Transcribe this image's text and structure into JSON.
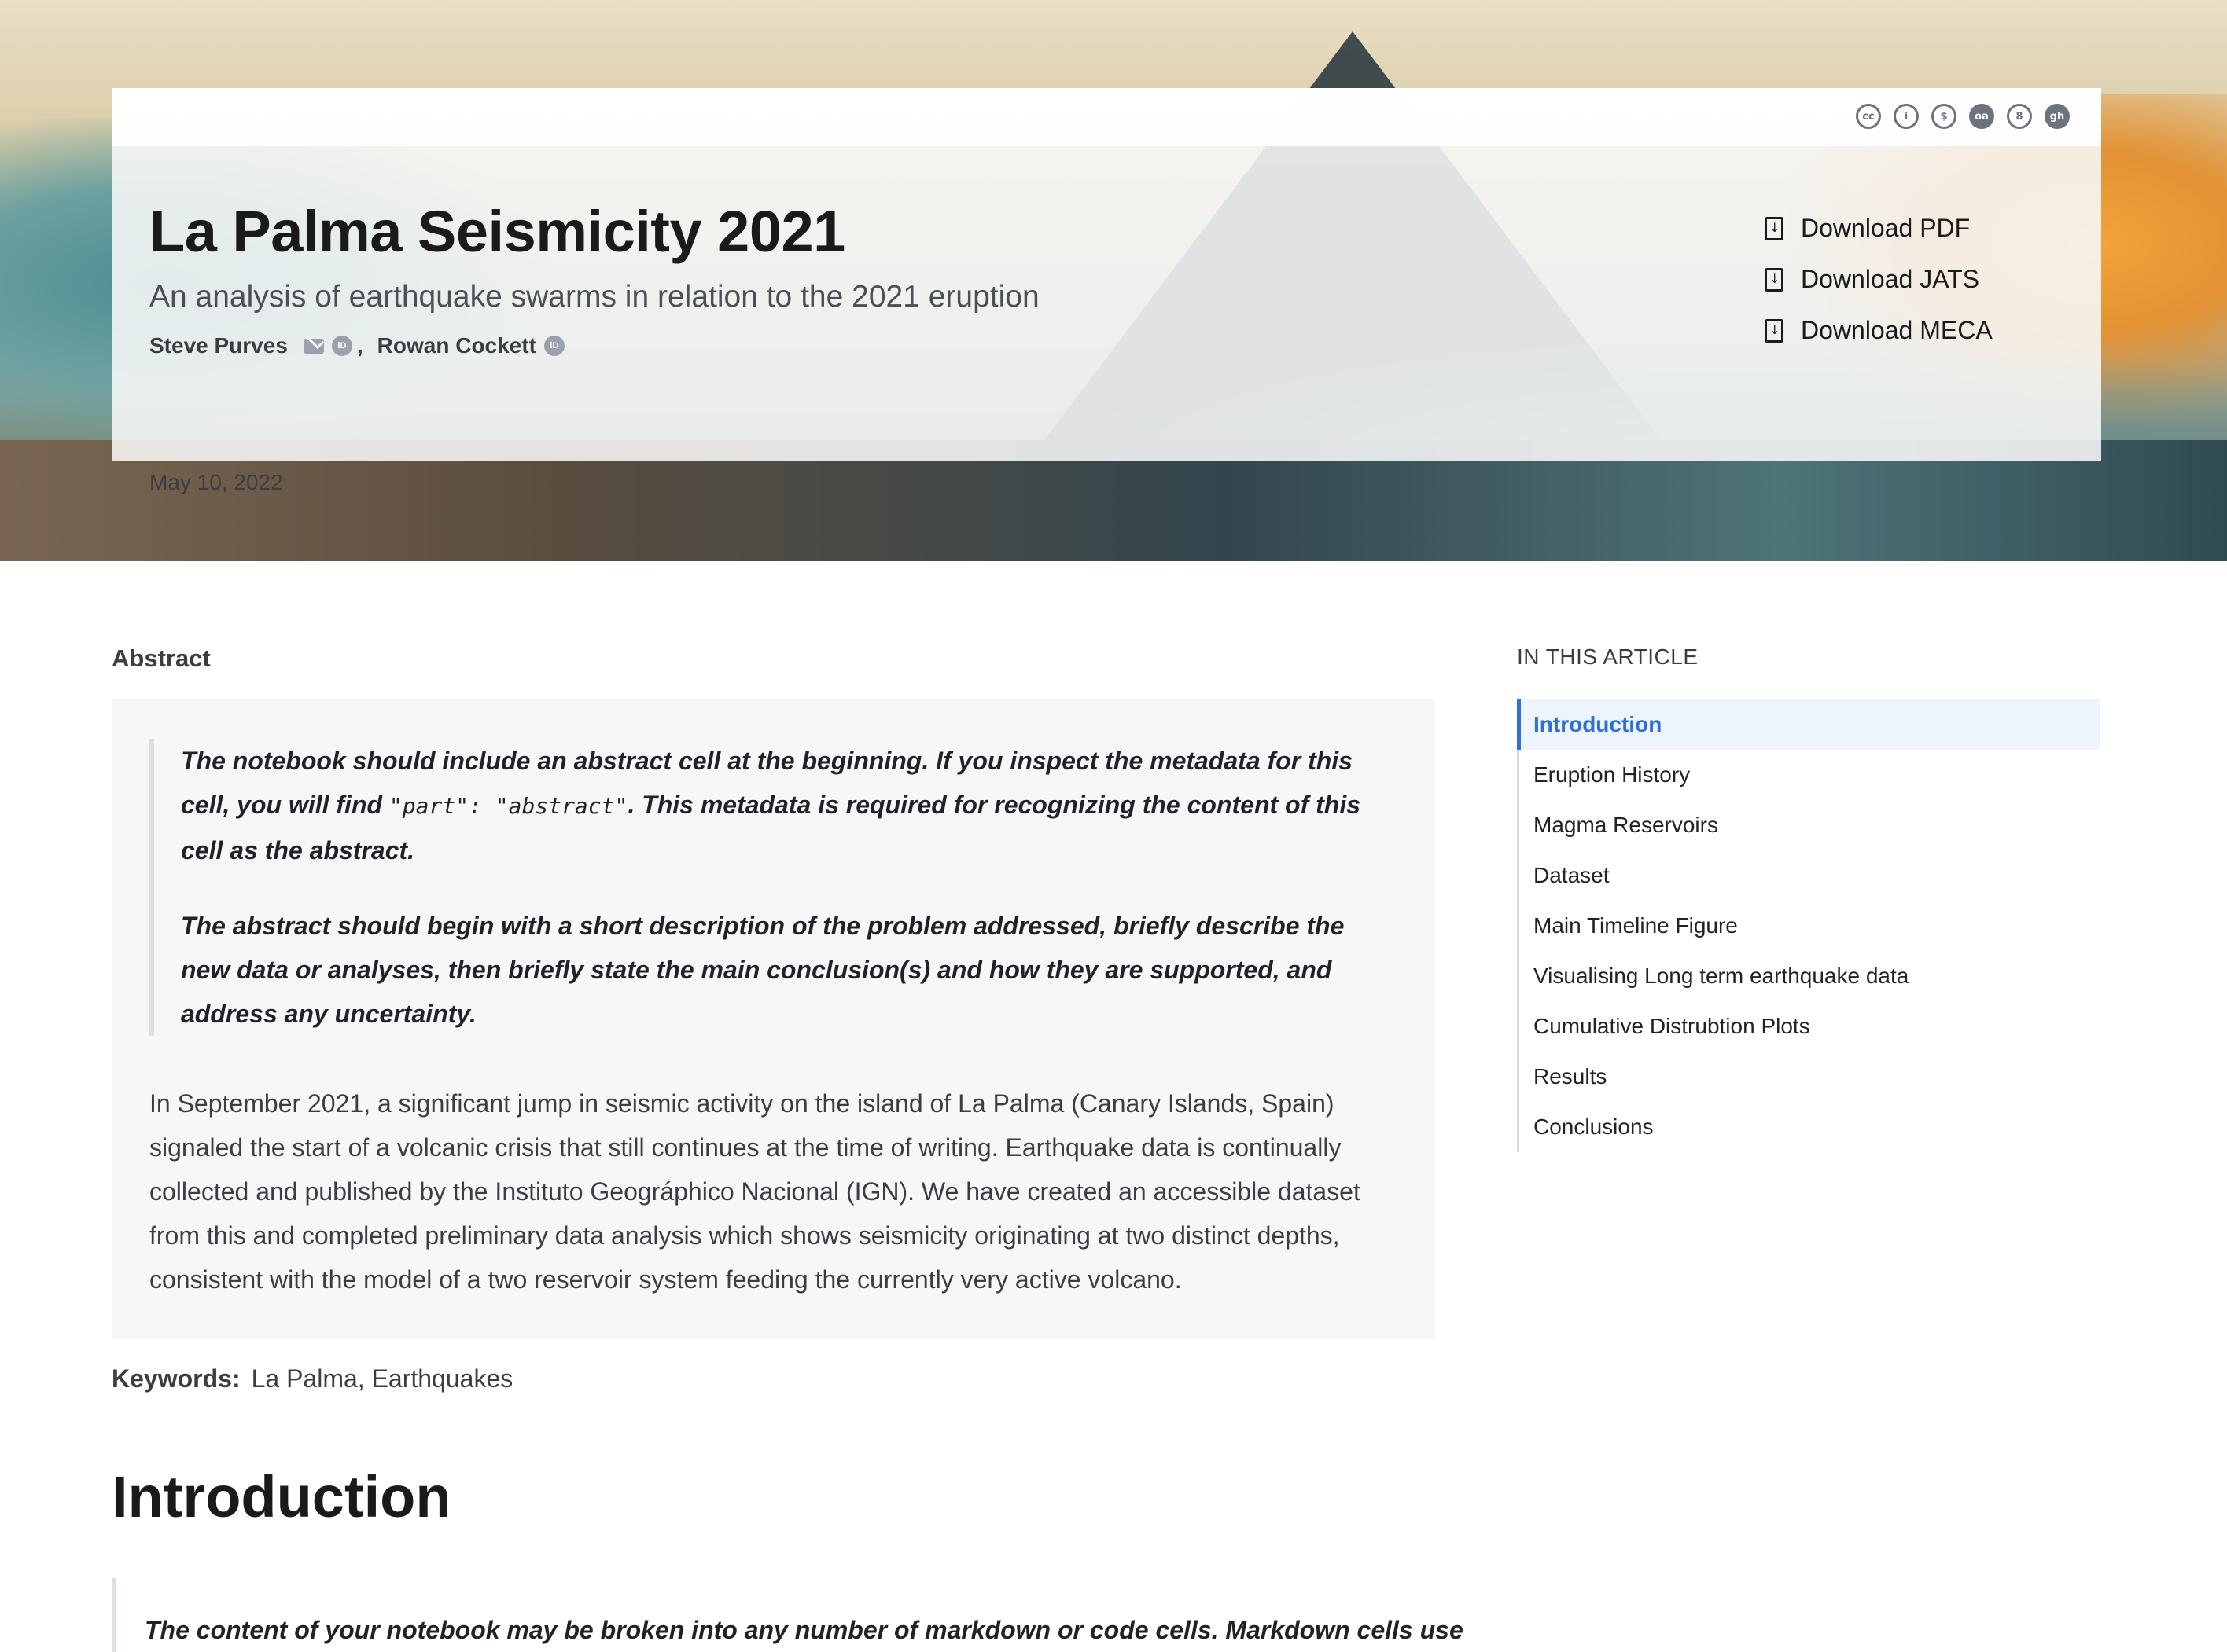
{
  "banner": {
    "badges": [
      "cc",
      "i",
      "$",
      "oa",
      "8",
      "gh"
    ]
  },
  "header": {
    "title": "La Palma Seismicity 2021",
    "subtitle": "An analysis of earthquake swarms in relation to the 2021 eruption",
    "authors": [
      {
        "name": "Steve Purves"
      },
      {
        "name": "Rowan Cockett"
      }
    ],
    "comma": ",",
    "date": "May 10, 2022",
    "downloads": [
      "Download PDF",
      "Download JATS",
      "Download MECA"
    ]
  },
  "abstract": {
    "heading": "Abstract",
    "quote_p1_a": "The notebook should include an abstract cell at the beginning. If you inspect the metadata for this cell, you will find ",
    "quote_p1_code": "\"part\": \"abstract\"",
    "quote_p1_b": ". This metadata is required for recognizing the content of this cell as the abstract.",
    "quote_p2": "The abstract should begin with a short description of the problem addressed, briefly describe the new data or analyses, then briefly state the main conclusion(s) and how they are supported, and address any uncertainty.",
    "text": "In September 2021, a significant jump in seismic activity on the island of La Palma (Canary Islands, Spain) signaled the start of a volcanic crisis that still continues at the time of writing. Earthquake data is continually collected and published by the Instituto Geográphico Nacional (IGN). We have created an accessible dataset from this and completed preliminary data analysis which shows seismicity originating at two distinct depths, consistent with the model of a two reservoir system feeding the currently very active volcano."
  },
  "keywords": {
    "label": "Keywords:",
    "value": "La Palma, Earthquakes"
  },
  "intro": {
    "heading": "Introduction",
    "quote": "The content of your notebook may be broken into any number of markdown or code cells. Markdown cells use"
  },
  "toc": {
    "heading": "IN THIS ARTICLE",
    "items": [
      "Introduction",
      "Eruption History",
      "Magma Reservoirs",
      "Dataset",
      "Main Timeline Figure",
      "Visualising Long term earthquake data",
      "Cumulative Distrubtion Plots",
      "Results",
      "Conclusions"
    ],
    "active_index": 0
  }
}
